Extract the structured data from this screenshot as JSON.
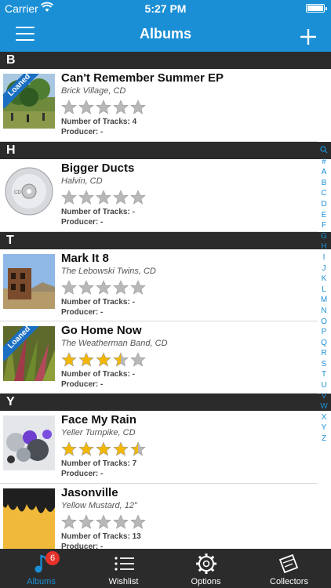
{
  "status_bar": {
    "carrier": "Carrier",
    "time": "5:27 PM"
  },
  "nav_bar": {
    "title": "Albums"
  },
  "sections": [
    {
      "letter": "B"
    },
    {
      "letter": "H"
    },
    {
      "letter": "T"
    },
    {
      "letter": "Y"
    }
  ],
  "albums": [
    {
      "title": "Can't Remember Summer EP",
      "subtitle": "Brick Village, CD",
      "rating": 0,
      "tracks": "Number of Tracks: 4",
      "producer": "Producer: -",
      "loaned": true,
      "loaned_label": "Loaned"
    },
    {
      "title": "Bigger Ducts",
      "subtitle": "Halvin, CD",
      "rating": 0,
      "tracks": "Number of Tracks: -",
      "producer": "Producer: -",
      "loaned": false
    },
    {
      "title": "Mark It 8",
      "subtitle": "The Lebowski Twins, CD",
      "rating": 0,
      "tracks": "Number of Tracks: -",
      "producer": "Producer: -",
      "loaned": false
    },
    {
      "title": "Go Home Now",
      "subtitle": "The Weatherman Band, CD",
      "rating": 3.5,
      "tracks": "Number of Tracks: -",
      "producer": "Producer: -",
      "loaned": true,
      "loaned_label": "Loaned"
    },
    {
      "title": "Face My Rain",
      "subtitle": "Yeller Turnpike, CD",
      "rating": 4.5,
      "tracks": "Number of Tracks: 7",
      "producer": "Producer: -",
      "loaned": false
    },
    {
      "title": "Jasonville",
      "subtitle": "Yellow Mustard, 12\"",
      "rating": 0,
      "tracks": "Number of Tracks: 13",
      "producer": "Producer: -",
      "loaned": false
    }
  ],
  "index_letters": [
    "#",
    "A",
    "B",
    "C",
    "D",
    "E",
    "F",
    "G",
    "H",
    "I",
    "J",
    "K",
    "L",
    "M",
    "N",
    "O",
    "P",
    "Q",
    "R",
    "S",
    "T",
    "U",
    "V",
    "W",
    "X",
    "Y",
    "Z"
  ],
  "tabs": [
    {
      "label": "Albums",
      "badge": "6",
      "icon": "music-note-icon"
    },
    {
      "label": "Wishlist",
      "icon": "star-list-icon"
    },
    {
      "label": "Options",
      "icon": "gear-icon"
    },
    {
      "label": "Collectors",
      "icon": "collectors-icon"
    }
  ],
  "colors": {
    "accent": "#1a8fd5",
    "star_filled": "#f2b705",
    "star_empty": "#b8b8b8",
    "badge": "#e6312b"
  }
}
